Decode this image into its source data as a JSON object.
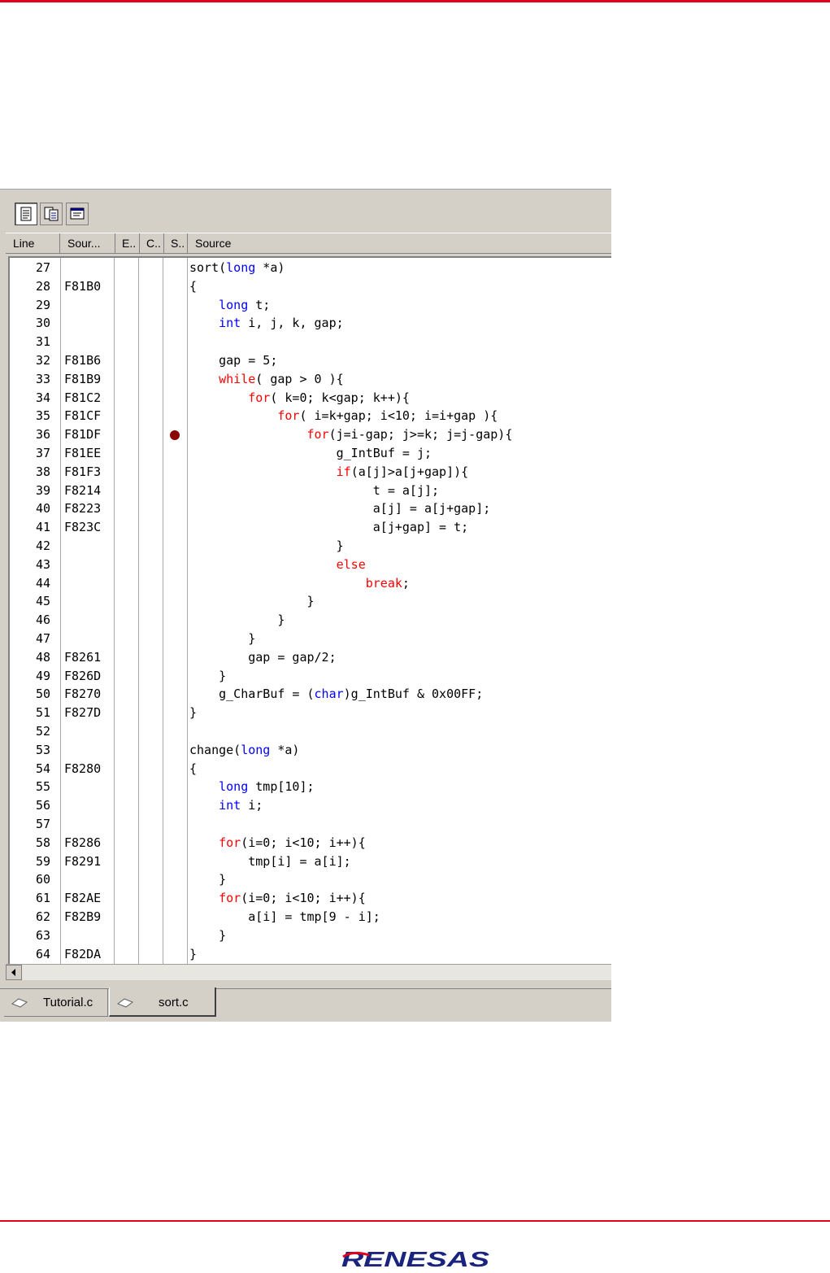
{
  "colors": {
    "accent_line": "#e2001a",
    "keyword_blue": "#0000ff",
    "keyword_red": "#ff0000",
    "breakpoint": "#8b0000"
  },
  "toolbar": {
    "buttons": [
      {
        "icon": "source-mode-icon",
        "pressed": true
      },
      {
        "icon": "mixed-mode-icon",
        "pressed": false
      },
      {
        "icon": "disassembly-mode-icon",
        "pressed": false
      }
    ]
  },
  "columns": [
    "Line",
    "Sour...",
    "E..",
    "C..",
    "S..",
    "Source"
  ],
  "rows": [
    {
      "line": "27",
      "addr": "",
      "src": [
        [
          "sort(",
          ""
        ],
        [
          "long",
          "b"
        ],
        [
          " *a)",
          ""
        ]
      ]
    },
    {
      "line": "28",
      "addr": "F81B0",
      "src": [
        [
          "{",
          ""
        ]
      ]
    },
    {
      "line": "29",
      "addr": "",
      "src": [
        [
          "    ",
          ""
        ],
        [
          "long",
          "b"
        ],
        [
          " t;",
          ""
        ]
      ]
    },
    {
      "line": "30",
      "addr": "",
      "src": [
        [
          "    ",
          ""
        ],
        [
          "int",
          "b"
        ],
        [
          " i, j, k, gap;",
          ""
        ]
      ]
    },
    {
      "line": "31",
      "addr": "",
      "src": []
    },
    {
      "line": "32",
      "addr": "F81B6",
      "src": [
        [
          "    gap = 5;",
          ""
        ]
      ]
    },
    {
      "line": "33",
      "addr": "F81B9",
      "src": [
        [
          "    ",
          ""
        ],
        [
          "while",
          "r"
        ],
        [
          "( gap > 0 ){",
          ""
        ]
      ]
    },
    {
      "line": "34",
      "addr": "F81C2",
      "src": [
        [
          "        ",
          ""
        ],
        [
          "for",
          "r"
        ],
        [
          "( k=0; k<gap; k++){",
          ""
        ]
      ]
    },
    {
      "line": "35",
      "addr": "F81CF",
      "src": [
        [
          "            ",
          ""
        ],
        [
          "for",
          "r"
        ],
        [
          "( i=k+gap; i<10; i=i+gap ){",
          ""
        ]
      ]
    },
    {
      "line": "36",
      "addr": "F81DF",
      "bp": true,
      "src": [
        [
          "                ",
          ""
        ],
        [
          "for",
          "r"
        ],
        [
          "(j=i-gap; j>=k; j=j-gap){",
          ""
        ]
      ]
    },
    {
      "line": "37",
      "addr": "F81EE",
      "src": [
        [
          "                    g_IntBuf = j;",
          ""
        ]
      ]
    },
    {
      "line": "38",
      "addr": "F81F3",
      "src": [
        [
          "                    ",
          ""
        ],
        [
          "if",
          "r"
        ],
        [
          "(a[j]>a[j+gap]){",
          ""
        ]
      ]
    },
    {
      "line": "39",
      "addr": "F8214",
      "src": [
        [
          "                         t = a[j];",
          ""
        ]
      ]
    },
    {
      "line": "40",
      "addr": "F8223",
      "src": [
        [
          "                         a[j] = a[j+gap];",
          ""
        ]
      ]
    },
    {
      "line": "41",
      "addr": "F823C",
      "src": [
        [
          "                         a[j+gap] = t;",
          ""
        ]
      ]
    },
    {
      "line": "42",
      "addr": "",
      "src": [
        [
          "                    }",
          ""
        ]
      ]
    },
    {
      "line": "43",
      "addr": "",
      "src": [
        [
          "                    ",
          ""
        ],
        [
          "else",
          "r"
        ]
      ]
    },
    {
      "line": "44",
      "addr": "",
      "src": [
        [
          "                        ",
          ""
        ],
        [
          "break",
          "r"
        ],
        [
          ";",
          ""
        ]
      ]
    },
    {
      "line": "45",
      "addr": "",
      "src": [
        [
          "                }",
          ""
        ]
      ]
    },
    {
      "line": "46",
      "addr": "",
      "src": [
        [
          "            }",
          ""
        ]
      ]
    },
    {
      "line": "47",
      "addr": "",
      "src": [
        [
          "        }",
          ""
        ]
      ]
    },
    {
      "line": "48",
      "addr": "F8261",
      "src": [
        [
          "        gap = gap/2;",
          ""
        ]
      ]
    },
    {
      "line": "49",
      "addr": "F826D",
      "src": [
        [
          "    }",
          ""
        ]
      ]
    },
    {
      "line": "50",
      "addr": "F8270",
      "src": [
        [
          "    g_CharBuf = (",
          ""
        ],
        [
          "char",
          "b"
        ],
        [
          ")g_IntBuf & 0x00FF;",
          ""
        ]
      ]
    },
    {
      "line": "51",
      "addr": "F827D",
      "src": [
        [
          "}",
          ""
        ]
      ]
    },
    {
      "line": "52",
      "addr": "",
      "src": []
    },
    {
      "line": "53",
      "addr": "",
      "src": [
        [
          "change(",
          ""
        ],
        [
          "long",
          "b"
        ],
        [
          " *a)",
          ""
        ]
      ]
    },
    {
      "line": "54",
      "addr": "F8280",
      "src": [
        [
          "{",
          ""
        ]
      ]
    },
    {
      "line": "55",
      "addr": "",
      "src": [
        [
          "    ",
          ""
        ],
        [
          "long",
          "b"
        ],
        [
          " tmp[10];",
          ""
        ]
      ]
    },
    {
      "line": "56",
      "addr": "",
      "src": [
        [
          "    ",
          ""
        ],
        [
          "int",
          "b"
        ],
        [
          " i;",
          ""
        ]
      ]
    },
    {
      "line": "57",
      "addr": "",
      "src": []
    },
    {
      "line": "58",
      "addr": "F8286",
      "src": [
        [
          "    ",
          ""
        ],
        [
          "for",
          "r"
        ],
        [
          "(i=0; i<10; i++){",
          ""
        ]
      ]
    },
    {
      "line": "59",
      "addr": "F8291",
      "src": [
        [
          "        tmp[i] = a[i];",
          ""
        ]
      ]
    },
    {
      "line": "60",
      "addr": "",
      "src": [
        [
          "    }",
          ""
        ]
      ]
    },
    {
      "line": "61",
      "addr": "F82AE",
      "src": [
        [
          "    ",
          ""
        ],
        [
          "for",
          "r"
        ],
        [
          "(i=0; i<10; i++){",
          ""
        ]
      ]
    },
    {
      "line": "62",
      "addr": "F82B9",
      "src": [
        [
          "        a[i] = tmp[9 - i];",
          ""
        ]
      ]
    },
    {
      "line": "63",
      "addr": "",
      "src": [
        [
          "    }",
          ""
        ]
      ]
    },
    {
      "line": "64",
      "addr": "F82DA",
      "src": [
        [
          "}",
          ""
        ]
      ]
    }
  ],
  "tabs": [
    {
      "label": "Tutorial.c",
      "active": false
    },
    {
      "label": "sort.c",
      "active": true
    }
  ],
  "logo": "RENESAS"
}
